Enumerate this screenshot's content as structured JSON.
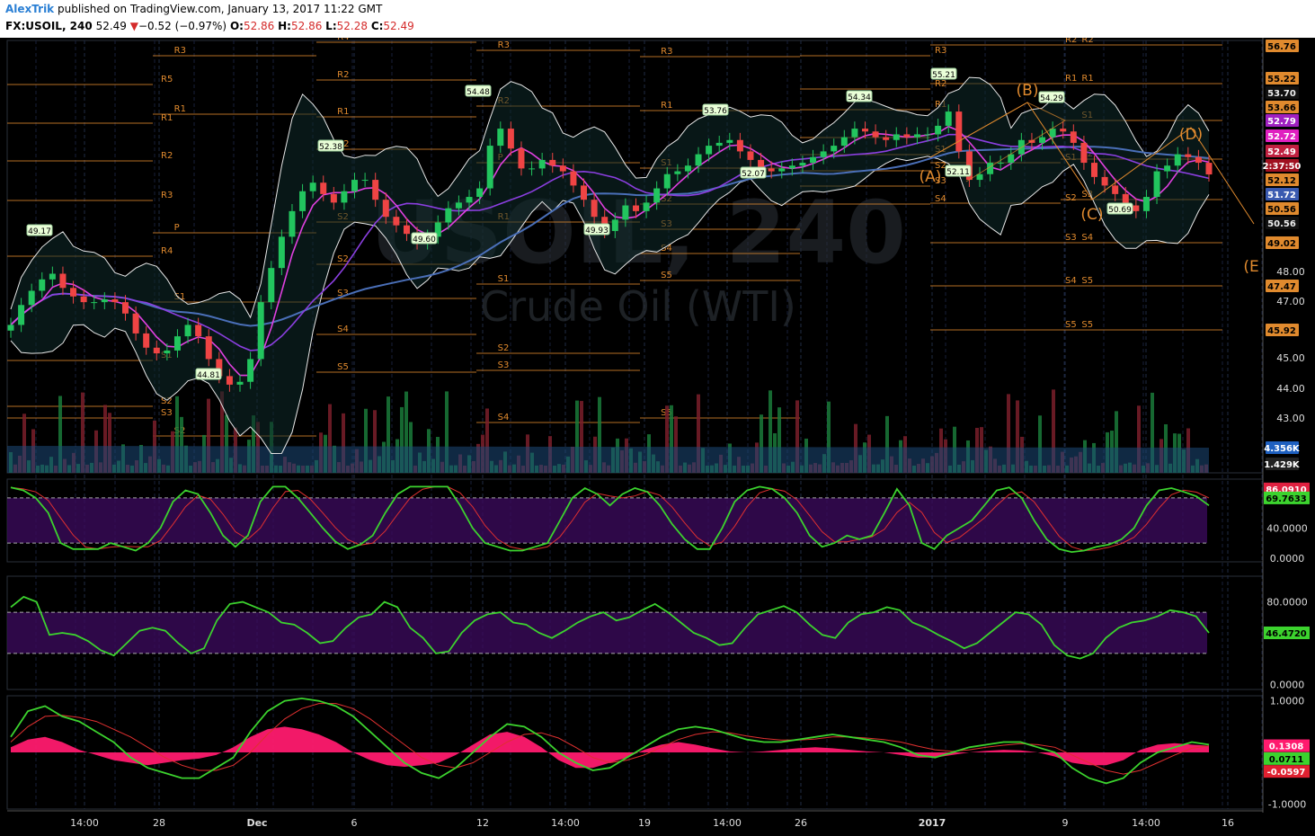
{
  "header": {
    "author": "AlexTrik",
    "published": "published on TradingView.com, January 13, 2017 11:22 GMT",
    "symbol": "FX:USOIL, 240",
    "last": "52.49",
    "change_arrow": "▼",
    "change": "−0.52 (−0.97%)",
    "o_label": "O:",
    "o": "52.86",
    "h_label": "H:",
    "h": "52.86",
    "l_label": "L:",
    "l": "52.28",
    "c_label": "C:",
    "c": "52.49"
  },
  "watermark": {
    "line1": "USOIL, 240",
    "line2": "Crude Oil (WTI)"
  },
  "colors": {
    "background": "#000000",
    "up_candle": "#22c55e",
    "down_candle": "#ef4444",
    "ma_fast": "#e040e0",
    "ma_mid": "#8b3fe0",
    "ma_slow": "#4a6fb8",
    "bollinger": "#e8e8e8",
    "pivot": "#e08a2e",
    "indicator_line": "#3cd32e",
    "signal_line": "#e03030",
    "histogram": "#ff1a6e",
    "osc_band": "#3a0a5a"
  },
  "chart_data": [
    {
      "type": "candlestick",
      "name": "price",
      "x_labels": [
        "14:00",
        "28",
        "Dec",
        "6",
        "12",
        "14:00",
        "19",
        "14:00",
        "26",
        "2017",
        "9",
        "14:00",
        "16"
      ],
      "y_ticks": [
        "48.00",
        "47.00",
        "45.00",
        "44.00",
        "43.00"
      ],
      "ylim": [
        42.0,
        57.2
      ],
      "close": [
        47.2,
        47.9,
        48.4,
        48.8,
        49.0,
        48.5,
        48.2,
        48.0,
        48.0,
        48.1,
        48.0,
        47.6,
        46.9,
        46.4,
        46.2,
        46.3,
        46.8,
        47.2,
        46.8,
        46.0,
        45.4,
        45.1,
        45.2,
        46.0,
        48.0,
        49.2,
        50.3,
        51.2,
        51.9,
        52.2,
        51.8,
        51.5,
        51.9,
        52.3,
        52.3,
        51.6,
        51.0,
        50.7,
        50.4,
        50.1,
        50.3,
        50.8,
        51.3,
        51.5,
        51.7,
        52.0,
        53.5,
        54.1,
        53.4,
        52.7,
        52.7,
        53.0,
        52.8,
        52.6,
        52.1,
        51.6,
        51.0,
        50.5,
        50.9,
        51.4,
        51.2,
        51.5,
        52.0,
        52.5,
        52.6,
        52.8,
        53.2,
        53.5,
        53.6,
        53.7,
        53.3,
        53.0,
        52.7,
        52.6,
        52.7,
        52.8,
        52.9,
        53.1,
        53.3,
        53.5,
        53.8,
        54.1,
        54.0,
        53.8,
        53.7,
        53.9,
        53.8,
        53.9,
        53.9,
        54.2,
        54.7,
        53.3,
        52.3,
        52.5,
        52.9,
        52.9,
        53.2,
        53.7,
        53.6,
        53.8,
        54.1,
        54.0,
        53.6,
        52.9,
        52.4,
        52.1,
        51.8,
        51.4,
        51.2,
        51.7,
        52.6,
        52.8,
        53.2,
        53.1,
        52.9,
        52.49
      ],
      "levels_right": [
        "56.76",
        "55.22",
        "53.70",
        "53.66",
        "52.79",
        "52.72",
        "52.49",
        "2:37:50",
        "52.12",
        "51.72",
        "50.56",
        "50.56",
        "49.02",
        "47.47",
        "45.92"
      ],
      "pivot_labels": [
        "R4",
        "R3",
        "R2",
        "R1",
        "P",
        "S1",
        "S2",
        "S3",
        "S4",
        "S5",
        "R5",
        "R1",
        "R2",
        "R3",
        "R4",
        "S1",
        "S2",
        "S3",
        "S4",
        "S5",
        "R1",
        "R2",
        "R3",
        "R2",
        "R1",
        "S1",
        "S2",
        "S3",
        "S4",
        "S1",
        "S2",
        "S3",
        "S4",
        "S5",
        "R3",
        "R2",
        "R1",
        "P",
        "S1",
        "S2",
        "S3",
        "S4",
        "R2",
        "R1",
        "S1",
        "S2",
        "S3",
        "S4",
        "S5"
      ],
      "annotations": [
        "49.17",
        "44.81",
        "52.38",
        "49.60",
        "54.48",
        "49.93",
        "53.76",
        "52.07",
        "54.34",
        "55.21",
        "52.11",
        "54.29",
        "50.69"
      ],
      "wave_labels": [
        "(A)",
        "(B)",
        "(C)",
        "(D)",
        "(E"
      ]
    },
    {
      "type": "bar",
      "name": "volume",
      "levels_right": [
        "4.356K",
        "1.429K"
      ]
    },
    {
      "type": "line",
      "name": "stochastic",
      "y_ticks": [
        "40.0000",
        "0.0000"
      ],
      "ylim": [
        -5,
        105
      ],
      "bands": [
        80,
        20
      ],
      "levels_right": [
        "86.0910",
        "69.7633"
      ],
      "k": [
        94,
        90,
        80,
        60,
        20,
        12,
        12,
        12,
        20,
        15,
        10,
        20,
        40,
        75,
        90,
        85,
        60,
        30,
        15,
        30,
        75,
        95,
        95,
        80,
        60,
        40,
        22,
        12,
        18,
        30,
        60,
        85,
        95,
        95,
        95,
        95,
        70,
        40,
        20,
        15,
        10,
        10,
        15,
        20,
        50,
        80,
        93,
        85,
        70,
        85,
        93,
        88,
        70,
        45,
        25,
        12,
        12,
        40,
        75,
        90,
        95,
        92,
        80,
        60,
        30,
        15,
        20,
        30,
        25,
        30,
        60,
        92,
        70,
        20,
        12,
        30,
        40,
        50,
        70,
        90,
        94,
        80,
        50,
        25,
        12,
        8,
        10,
        15,
        18,
        25,
        40,
        70,
        90,
        93,
        88,
        82,
        70
      ]
    },
    {
      "type": "line",
      "name": "rsi",
      "y_ticks": [
        "80.0000",
        "0.0000"
      ],
      "ylim": [
        -5,
        105
      ],
      "bands": [
        70,
        30
      ],
      "levels_right": [
        "46.4720"
      ],
      "rsi": [
        75,
        85,
        80,
        48,
        50,
        48,
        42,
        33,
        28,
        40,
        52,
        55,
        52,
        40,
        30,
        35,
        62,
        78,
        80,
        75,
        70,
        60,
        58,
        50,
        40,
        42,
        55,
        65,
        68,
        80,
        75,
        55,
        45,
        30,
        32,
        50,
        62,
        68,
        70,
        60,
        58,
        50,
        45,
        52,
        60,
        66,
        70,
        62,
        65,
        72,
        78,
        70,
        60,
        50,
        45,
        38,
        40,
        55,
        68,
        72,
        76,
        70,
        58,
        48,
        45,
        60,
        68,
        70,
        75,
        72,
        60,
        55,
        48,
        42,
        35,
        40,
        50,
        60,
        70,
        68,
        58,
        38,
        28,
        25,
        30,
        45,
        55,
        60,
        62,
        66,
        72,
        70,
        66,
        50
      ]
    },
    {
      "type": "line",
      "name": "macd",
      "y_ticks": [
        "1.0000",
        "-1.0000"
      ],
      "ylim": [
        -1.1,
        1.1
      ],
      "levels_right": [
        "0.1308",
        "0.0711",
        "-0.0597"
      ],
      "macd": [
        0.3,
        0.8,
        0.9,
        0.7,
        0.6,
        0.4,
        0.2,
        -0.1,
        -0.3,
        -0.4,
        -0.5,
        -0.5,
        -0.3,
        -0.1,
        0.4,
        0.8,
        1.0,
        1.05,
        1.0,
        0.9,
        0.7,
        0.4,
        0.1,
        -0.2,
        -0.4,
        -0.5,
        -0.3,
        0.0,
        0.3,
        0.55,
        0.5,
        0.3,
        0.0,
        -0.2,
        -0.35,
        -0.3,
        -0.1,
        0.1,
        0.3,
        0.45,
        0.5,
        0.45,
        0.35,
        0.25,
        0.2,
        0.2,
        0.25,
        0.3,
        0.35,
        0.3,
        0.25,
        0.2,
        0.1,
        -0.05,
        -0.1,
        0.0,
        0.1,
        0.15,
        0.2,
        0.2,
        0.1,
        0.0,
        -0.3,
        -0.5,
        -0.6,
        -0.5,
        -0.2,
        0.0,
        0.1,
        0.2,
        0.15
      ],
      "signal": [
        0.2,
        0.5,
        0.7,
        0.72,
        0.68,
        0.6,
        0.45,
        0.3,
        0.1,
        -0.1,
        -0.25,
        -0.35,
        -0.35,
        -0.25,
        0.0,
        0.35,
        0.65,
        0.85,
        0.95,
        0.95,
        0.85,
        0.65,
        0.4,
        0.15,
        -0.1,
        -0.25,
        -0.3,
        -0.2,
        0.0,
        0.2,
        0.35,
        0.38,
        0.28,
        0.1,
        -0.1,
        -0.2,
        -0.15,
        -0.05,
        0.1,
        0.25,
        0.35,
        0.4,
        0.38,
        0.32,
        0.27,
        0.24,
        0.24,
        0.26,
        0.3,
        0.3,
        0.28,
        0.25,
        0.2,
        0.12,
        0.05,
        0.02,
        0.05,
        0.1,
        0.14,
        0.17,
        0.15,
        0.1,
        -0.05,
        -0.2,
        -0.35,
        -0.42,
        -0.35,
        -0.2,
        -0.05,
        0.08,
        0.13
      ],
      "hist": [
        0.1,
        0.25,
        0.3,
        0.2,
        0.05,
        -0.05,
        -0.15,
        -0.2,
        -0.25,
        -0.2,
        -0.15,
        -0.12,
        -0.05,
        0.1,
        0.3,
        0.45,
        0.5,
        0.45,
        0.35,
        0.2,
        0.0,
        -0.15,
        -0.25,
        -0.28,
        -0.25,
        -0.2,
        -0.05,
        0.15,
        0.35,
        0.4,
        0.3,
        0.1,
        -0.15,
        -0.3,
        -0.3,
        -0.2,
        -0.1,
        0.05,
        0.15,
        0.2,
        0.15,
        0.08,
        0.02,
        0.0,
        0.02,
        0.05,
        0.08,
        0.1,
        0.08,
        0.05,
        0.02,
        0.0,
        -0.05,
        -0.1,
        -0.1,
        -0.05,
        0.0,
        0.03,
        0.05,
        0.04,
        0.0,
        -0.08,
        -0.2,
        -0.25,
        -0.25,
        -0.15,
        0.05,
        0.15,
        0.18,
        0.15,
        0.13
      ]
    }
  ]
}
